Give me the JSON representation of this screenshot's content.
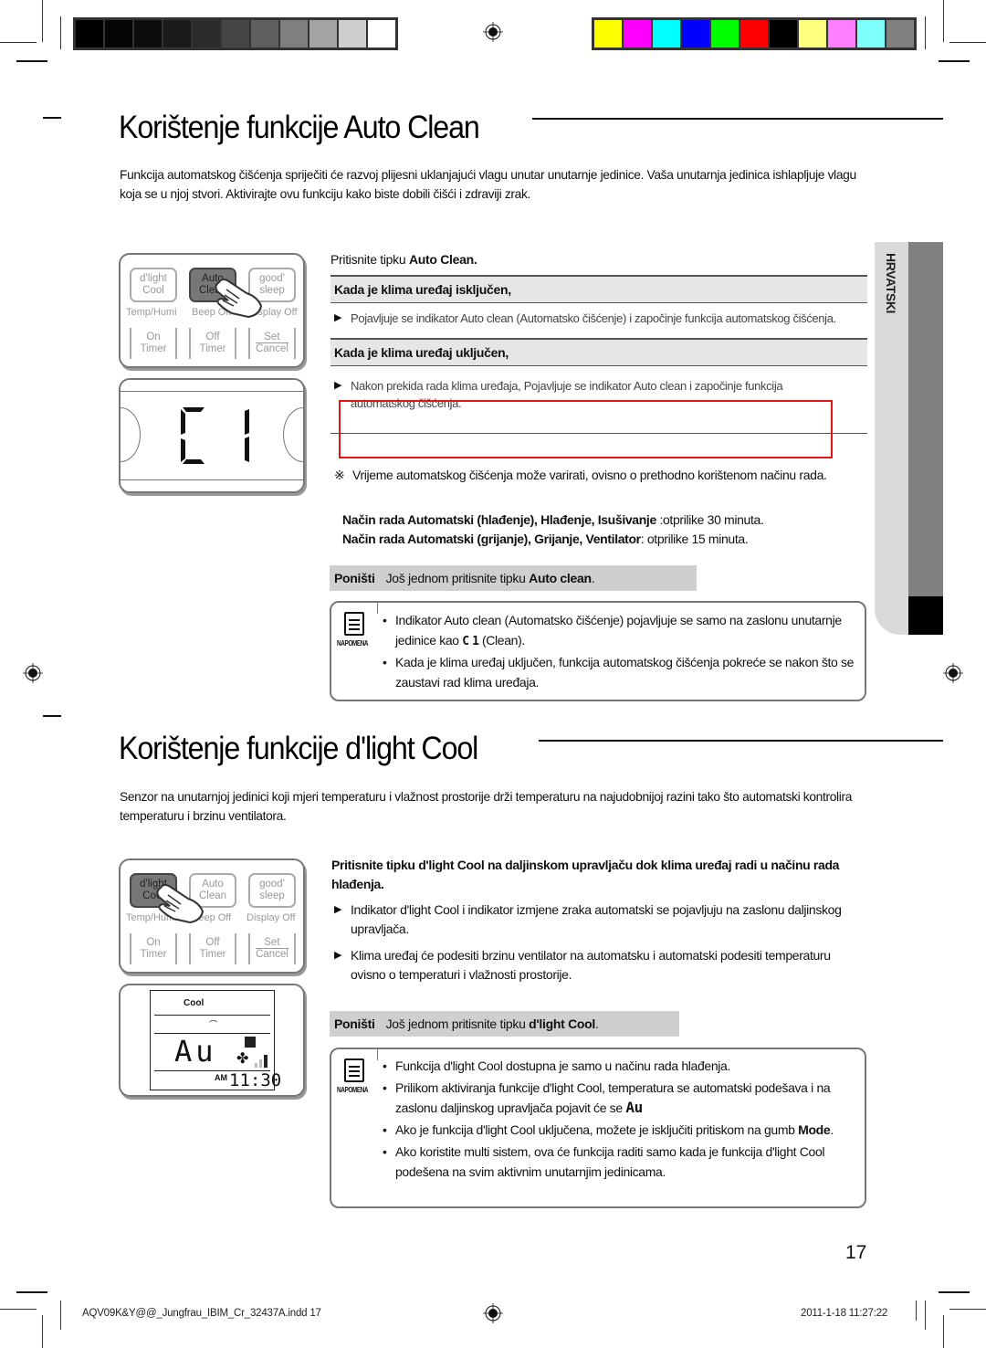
{
  "color_bars": {
    "grayscale": [
      "#000000",
      "#050505",
      "#0d0d0d",
      "#1a1a1a",
      "#2b2b2b",
      "#454545",
      "#5f5f5f",
      "#7f7f7f",
      "#a3a3a3",
      "#cfcfcf",
      "#ffffff"
    ],
    "colors": [
      "#ffff00",
      "#ff00ff",
      "#00ffff",
      "#0000ff",
      "#00ff00",
      "#ff0000",
      "#000000",
      "#ffff80",
      "#ff80ff",
      "#80ffff",
      "#808080"
    ]
  },
  "section1": {
    "title": "Korištenje funkcije Auto Clean",
    "intro": "Funkcija automatskog čišćenja spriječiti će razvoj plijesni uklanjajući vlagu unutar unutarnje jedinice. Vaša unutarnja jedinica ishlapljuje vlagu koja se u njoj stvori. Aktivirajte ovu funkciju kako biste dobili čišći i zdraviji zrak.",
    "remote": {
      "buttons": [
        {
          "l1": "d'light",
          "l2": "Cool"
        },
        {
          "l1": "Auto",
          "l2": "Clean"
        },
        {
          "l1": "good'",
          "l2": "sleep"
        }
      ],
      "labels": [
        "Temp/Humi",
        "Beep Off",
        "Display Off"
      ],
      "timer_buttons": [
        {
          "l1": "On",
          "l2": "Timer"
        },
        {
          "l1": "Off",
          "l2": "Timer"
        },
        {
          "l1": "Set",
          "l2": "Cancel"
        }
      ],
      "display_text": "C1"
    },
    "step_prefix": "Pritisnite tipku ",
    "step_bold": "Auto Clean.",
    "off_heading": "Kada je klima uređaj isključen,",
    "off_bullet": "Pojavljuje se indikator Auto clean (Automatsko čišćenje) i započinje funkcija automatskog čišćenja.",
    "on_heading": "Kada je klima uređaj uključen,",
    "on_bullet": "Nakon prekida rada klima uređaja, Pojavljuje se indikator Auto clean i započinje funkcija automatskog čišćenja.",
    "highlight_color": "#e8141b",
    "note_mark": "※",
    "time_note": "Vrijeme automatskog čišćenja može varirati, ovisno o prethodno korištenom načinu rada.",
    "mode1_bold": "Način rada Automatski (hlađenje), Hlađenje, Isušivanje",
    "mode1_rest": " :otprilike 30 minuta.",
    "mode2_bold": "Način rada Automatski (grijanje), Grijanje, Ventilator",
    "mode2_rest": ": otprilike 15 minuta.",
    "cancel_label": "Poništi",
    "cancel_text": "Još jednom pritisnite tipku ",
    "cancel_bold": "Auto clean",
    "cancel_end": ".",
    "note_label": "NAPOMENA",
    "notes": [
      {
        "a": "Indikator Auto clean (Automatsko čišćenje) pojavljuje se samo na zaslonu unutarnje jedinice kao ",
        "glyph": "C1",
        "b": "(Clean)."
      },
      {
        "a": "Kada je klima uređaj uključen, funkcija automatskog čišćenja pokreće se nakon što se zaustavi rad klima uređaja."
      }
    ]
  },
  "side_tab": {
    "label": "HRVATSKI"
  },
  "section2": {
    "title": "Korištenje funkcije d'light Cool",
    "intro": "Senzor na unutarnjoj jedinici koji mjeri temperaturu i vlažnost prostorije drži temperaturu na najudobnijoj razini tako što automatski kontrolira temperaturu i brzinu ventilatora.",
    "remote": {
      "buttons": [
        {
          "l1": "d'light",
          "l2": "Cool"
        },
        {
          "l1": "Auto",
          "l2": "Clean"
        },
        {
          "l1": "good'",
          "l2": "sleep"
        }
      ],
      "labels": [
        "Temp/Humi",
        "Beep Off",
        "Display Off"
      ],
      "timer_buttons": [
        {
          "l1": "On",
          "l2": "Timer"
        },
        {
          "l1": "Off",
          "l2": "Timer"
        },
        {
          "l1": "Set",
          "l2": "Cancel"
        }
      ],
      "lcd_mode": "Cool",
      "lcd_main": "Au",
      "lcd_ampm": "AM",
      "lcd_time": "11:30"
    },
    "step_a": "Pritisnite tipku ",
    "step_b": "d'light Cool",
    "step_c": " na daljinskom upravljaču dok klima uređaj radi u načinu rada hlađenja.",
    "bullets": [
      "Indikator d'light Cool i indikator izmjene zraka automatski se pojavljuju na zaslonu daljinskog upravljača.",
      "Klima uređaj će podesiti brzinu ventilator na automatsku i automatski podesiti temperaturu ovisno o temperaturi i vlažnosti prostorije."
    ],
    "cancel_label": "Poništi",
    "cancel_text": "Još jednom pritisnite tipku ",
    "cancel_bold": "d'light Cool",
    "cancel_end": ".",
    "note_label": "NAPOMENA",
    "notes": [
      {
        "a": "Funkcija d'light Cool dostupna je samo u načinu rada hlađenja."
      },
      {
        "a": "Prilikom aktiviranja funkcije d'light Cool, temperatura se automatski podešava i na zaslonu daljinskog upravljača pojavit će se ",
        "glyph": "Au"
      },
      {
        "a": "Ako je funkcija d'light Cool uključena, možete je isključiti pritiskom na gumb ",
        "bold": "Mode",
        "end": "."
      },
      {
        "a": "Ako koristite multi sistem, ova će funkcija raditi samo kada je funkcija d'light Cool podešena na svim aktivnim unutarnjim jedinicama."
      }
    ]
  },
  "page_number": "17",
  "footer": {
    "file": "AQV09K&Y@@_Jungfrau_IBIM_Cr_32437A.indd   17",
    "timestamp": "2011-1-18   11:27:22"
  }
}
